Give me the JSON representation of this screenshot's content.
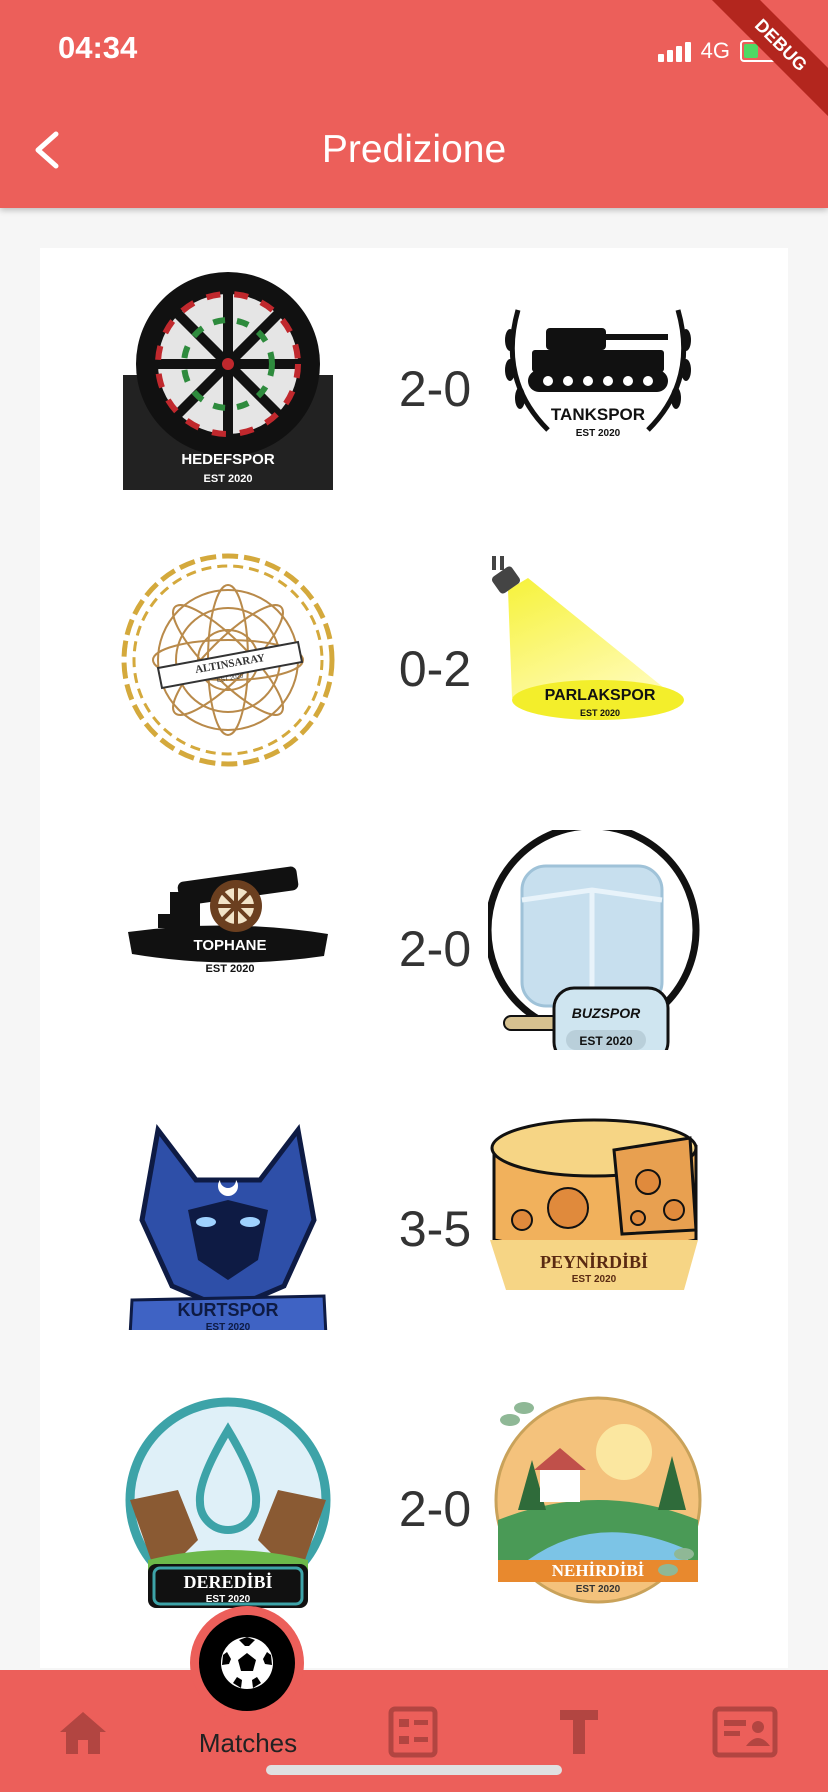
{
  "status": {
    "time": "04:34",
    "network": "4G",
    "debug_label": "DEBUG"
  },
  "header": {
    "title": "Predizione"
  },
  "matches": [
    {
      "home": {
        "name": "HEDEFSPOR",
        "est": "EST 2020"
      },
      "score": "2-0",
      "away": {
        "name": "TANKSPOR",
        "est": "EST 2020"
      }
    },
    {
      "home": {
        "name": "ALTINSARAY",
        "est": "EST 2020"
      },
      "score": "0-2",
      "away": {
        "name": "PARLAKSPOR",
        "est": "EST 2020"
      }
    },
    {
      "home": {
        "name": "TOPHANE",
        "est": "EST 2020"
      },
      "score": "2-0",
      "away": {
        "name": "BUZSPOR",
        "est": "EST 2020"
      }
    },
    {
      "home": {
        "name": "KURTSPOR",
        "est": "EST 2020"
      },
      "score": "3-5",
      "away": {
        "name": "PEYNİRDİBİ",
        "est": "EST 2020"
      }
    },
    {
      "home": {
        "name": "DEREDİBİ",
        "est": "EST 2020"
      },
      "score": "2-0",
      "away": {
        "name": "NEHİRDİBİ",
        "est": "EST 2020"
      }
    }
  ],
  "bottom_nav": {
    "active_label": "Matches",
    "items": [
      "home-icon",
      "matches-ball-icon",
      "list-icon",
      "text-icon",
      "contact-card-icon"
    ]
  },
  "colors": {
    "accent": "#ec5f5a",
    "nav_icon": "#b24541"
  }
}
